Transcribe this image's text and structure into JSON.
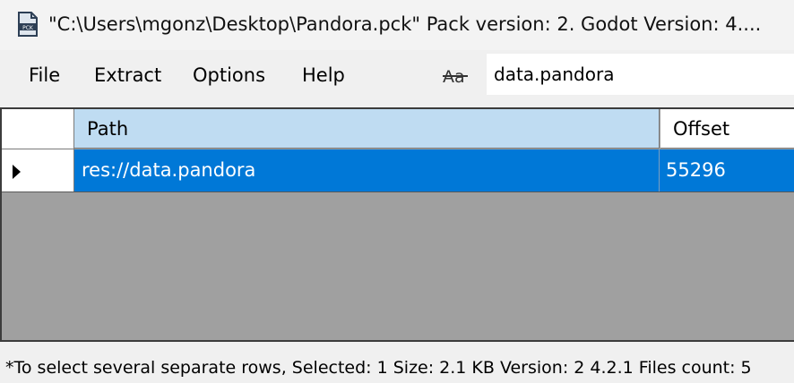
{
  "window": {
    "title": "\"C:\\Users\\mgonz\\Desktop\\Pandora.pck\" Pack version: 2. Godot Version: 4....",
    "icon": "pck-file-icon"
  },
  "menu": {
    "file": "File",
    "extract": "Extract",
    "options": "Options",
    "help": "Help"
  },
  "search": {
    "case_icon": "match-case-icon",
    "value": "data.pandora"
  },
  "grid": {
    "columns": [
      "Path",
      "Offset"
    ],
    "rows": [
      {
        "path": "res://data.pandora",
        "offset": "55296",
        "selected": true
      }
    ],
    "colors": {
      "selected_row": "#0078d7",
      "sorted_header": "#bfdcf2",
      "empty_area": "#a0a0a0"
    }
  },
  "status": {
    "text": "*To select several separate rows, Selected: 1 Size: 2.1 KB  Version: 2 4.2.1 Files count: 5"
  }
}
